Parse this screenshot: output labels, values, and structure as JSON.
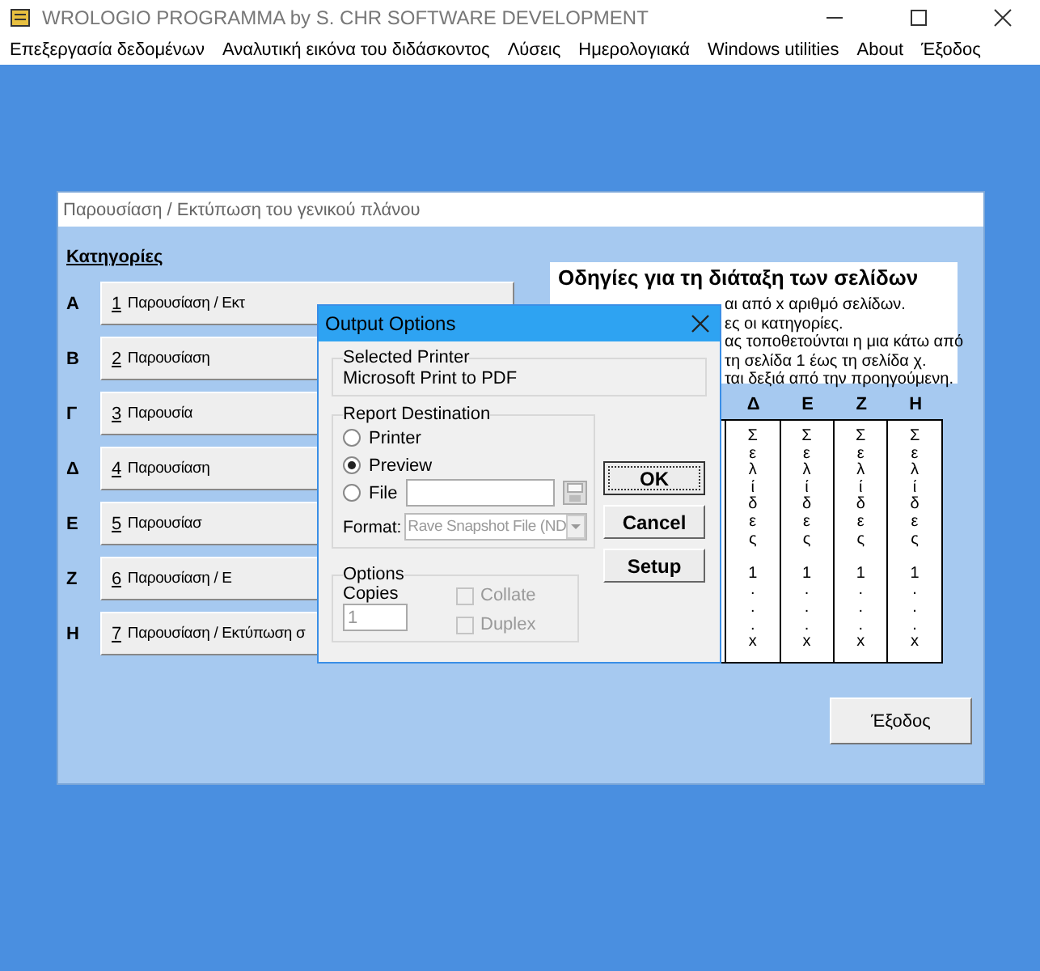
{
  "window": {
    "title": "WROLOGIO PROGRAMMA by S. CHR SOFTWARE DEVELOPMENT"
  },
  "menu": [
    "Επεξεργασία δεδομένων",
    "Αναλυτική εικόνα του διδάσκοντος",
    "Λύσεις",
    "Ημερολογιακά",
    "Windows utilities",
    "About",
    "Έξοδος"
  ],
  "panel": {
    "title": "Παρουσίαση / Εκτύπωση του γενικού πλάνου",
    "categories_label": "Κατηγορίες",
    "categories": [
      {
        "letter": "Α",
        "number": "1",
        "label": "Παρουσίαση / Εκτ"
      },
      {
        "letter": "Β",
        "number": "2",
        "label": "Παρουσίαση"
      },
      {
        "letter": "Γ",
        "number": "3",
        "label": "Παρουσία"
      },
      {
        "letter": "Δ",
        "number": "4",
        "label": "Παρουσίαση"
      },
      {
        "letter": "Ε",
        "number": "5",
        "label": "Παρουσίασ"
      },
      {
        "letter": "Ζ",
        "number": "6",
        "label": "Παρουσίαση / Ε"
      },
      {
        "letter": "Η",
        "number": "7",
        "label": "Παρουσίαση / Εκτύπωση σ"
      }
    ],
    "notes": {
      "title": "Οδηγίες για τη διάταξη των σελίδων",
      "lines": [
        "αι από x αριθμό σελίδων.",
        "ες οι κατηγορίες.",
        "ας τοποθετούνται η μια κάτω από",
        "τη σελίδα 1 έως τη σελίδα χ.",
        "ται δεξιά από την προηγούμενη."
      ]
    },
    "table": {
      "columns": [
        {
          "header": "Δ",
          "cell": "Σελίδες 1...x"
        },
        {
          "header": "Ε",
          "cell": "Σελίδες 1...x"
        },
        {
          "header": "Ζ",
          "cell": "Σελίδες 1...x"
        },
        {
          "header": "Η",
          "cell": "Σελίδες 1...x"
        }
      ]
    },
    "exit_button": "Έξοδος"
  },
  "dialog": {
    "title": "Output Options",
    "selected_printer_label": "Selected Printer",
    "selected_printer": "Microsoft Print to PDF",
    "destination_label": "Report Destination",
    "destinations": [
      {
        "label": "Printer",
        "selected": false
      },
      {
        "label": "Preview",
        "selected": true
      },
      {
        "label": "File",
        "selected": false
      }
    ],
    "format_label": "Format:",
    "format_value": "Rave Snapshot File (ND",
    "format_disabled": true,
    "options_label": "Options",
    "copies_label": "Copies",
    "copies_value": "1",
    "copies_disabled": true,
    "checkboxes": [
      {
        "label": "Collate",
        "checked": false,
        "disabled": true
      },
      {
        "label": "Duplex",
        "checked": false,
        "disabled": true
      }
    ],
    "buttons": [
      "OK",
      "Cancel",
      "Setup"
    ]
  }
}
